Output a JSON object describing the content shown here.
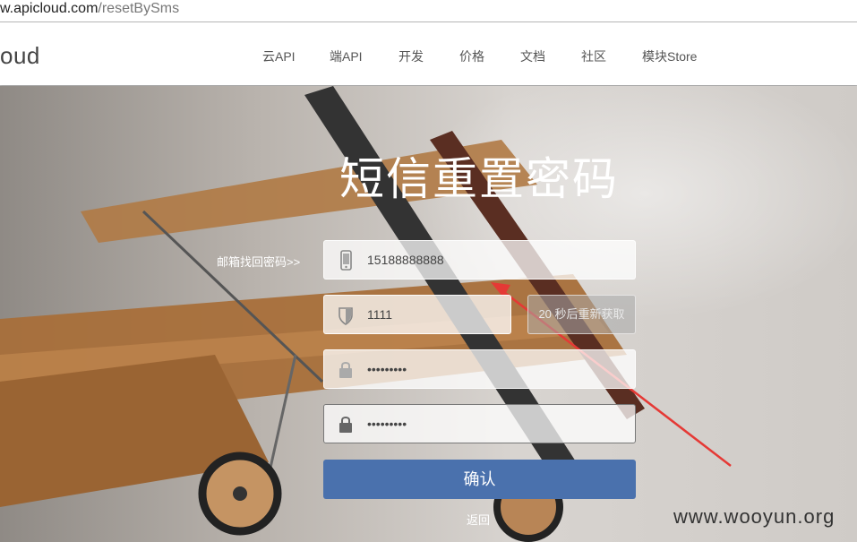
{
  "browser": {
    "url_host": "w.apicloud.com",
    "url_path": "/resetBySms"
  },
  "header": {
    "logo_text": "oud",
    "nav": [
      {
        "label": "云API"
      },
      {
        "label": "端API"
      },
      {
        "label": "开发"
      },
      {
        "label": "价格"
      },
      {
        "label": "文档"
      },
      {
        "label": "社区"
      },
      {
        "label": "模块Store"
      }
    ]
  },
  "form": {
    "title": "短信重置密码",
    "email_link": "邮箱找回密码>>",
    "phone": {
      "value": "15188888888",
      "icon": "phone-icon"
    },
    "code": {
      "value": "1111",
      "icon": "shield-icon"
    },
    "sms_button": "20 秒后重新获取",
    "password": {
      "value": "•••••••••",
      "icon": "lock-icon"
    },
    "password_confirm": {
      "value": "•••••••••",
      "icon": "lock-icon"
    },
    "confirm_button": "确认",
    "back_link": "返回"
  },
  "watermark": "www.wooyun.org",
  "colors": {
    "confirm_button": "#4a71ad",
    "annotation_arrow": "#e53935"
  }
}
